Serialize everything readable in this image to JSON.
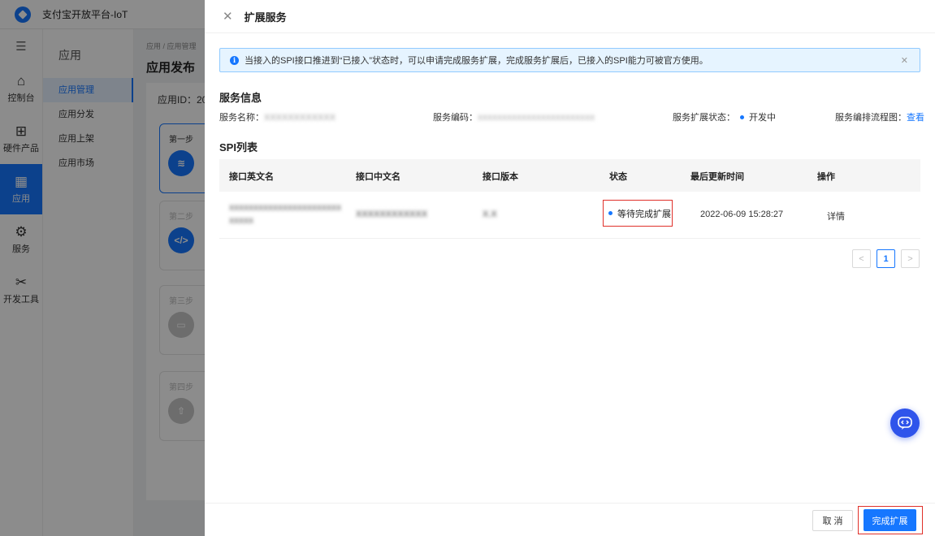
{
  "app": {
    "title": "支付宝开放平台-IoT"
  },
  "iconbar": {
    "items": [
      {
        "label": "控制台",
        "icon": "home-icon"
      },
      {
        "label": "硬件产品",
        "icon": "hardware-icon"
      },
      {
        "label": "应用",
        "icon": "apps-icon",
        "active": true
      },
      {
        "label": "服务",
        "icon": "gear-icon"
      },
      {
        "label": "开发工具",
        "icon": "tools-icon"
      }
    ]
  },
  "subnav": {
    "title": "应用",
    "items": [
      "应用管理",
      "应用分发",
      "应用上架",
      "应用市场"
    ],
    "active_index": 0
  },
  "content": {
    "breadcrumb": "应用 / 应用管理",
    "page_title": "应用发布",
    "app_id_label": "应用ID：20",
    "steps": [
      "第一步",
      "第二步",
      "第三步",
      "第四步"
    ]
  },
  "drawer": {
    "title": "扩展服务",
    "alert": "当接入的SPI接口推进到“已接入”状态时，可以申请完成服务扩展，完成服务扩展后，已接入的SPI能力可被官方使用。",
    "service_info": {
      "heading": "服务信息",
      "name_label": "服务名称：",
      "name_value": "XXXXXXXXXXXX",
      "code_label": "服务编码：",
      "code_value": "XXXXXXXXXXXXXXXXXXXXXXXX",
      "status_label": "服务扩展状态：",
      "status_value": "开发中",
      "flow_label": "服务编排流程图：",
      "flow_link": "查看"
    },
    "spi": {
      "heading": "SPI列表",
      "columns": [
        "接口英文名",
        "接口中文名",
        "接口版本",
        "状态",
        "最后更新时间",
        "操作"
      ],
      "rows": [
        {
          "en_name_1": "XXXXXXXXXXXXXXXXXXXXXXX",
          "en_name_2": "XXXXX",
          "cn_name": "XXXXXXXXXXXX",
          "version": "X.X",
          "status": "等待完成扩展",
          "updated": "2022-06-09 15:28:27",
          "action": "详情"
        }
      ]
    },
    "pagination": {
      "prev": "<",
      "current": "1",
      "next": ">"
    },
    "footer": {
      "cancel": "取 消",
      "confirm": "完成扩展"
    }
  },
  "colors": {
    "accent": "#1677ff",
    "highlight": "#e0302a"
  }
}
